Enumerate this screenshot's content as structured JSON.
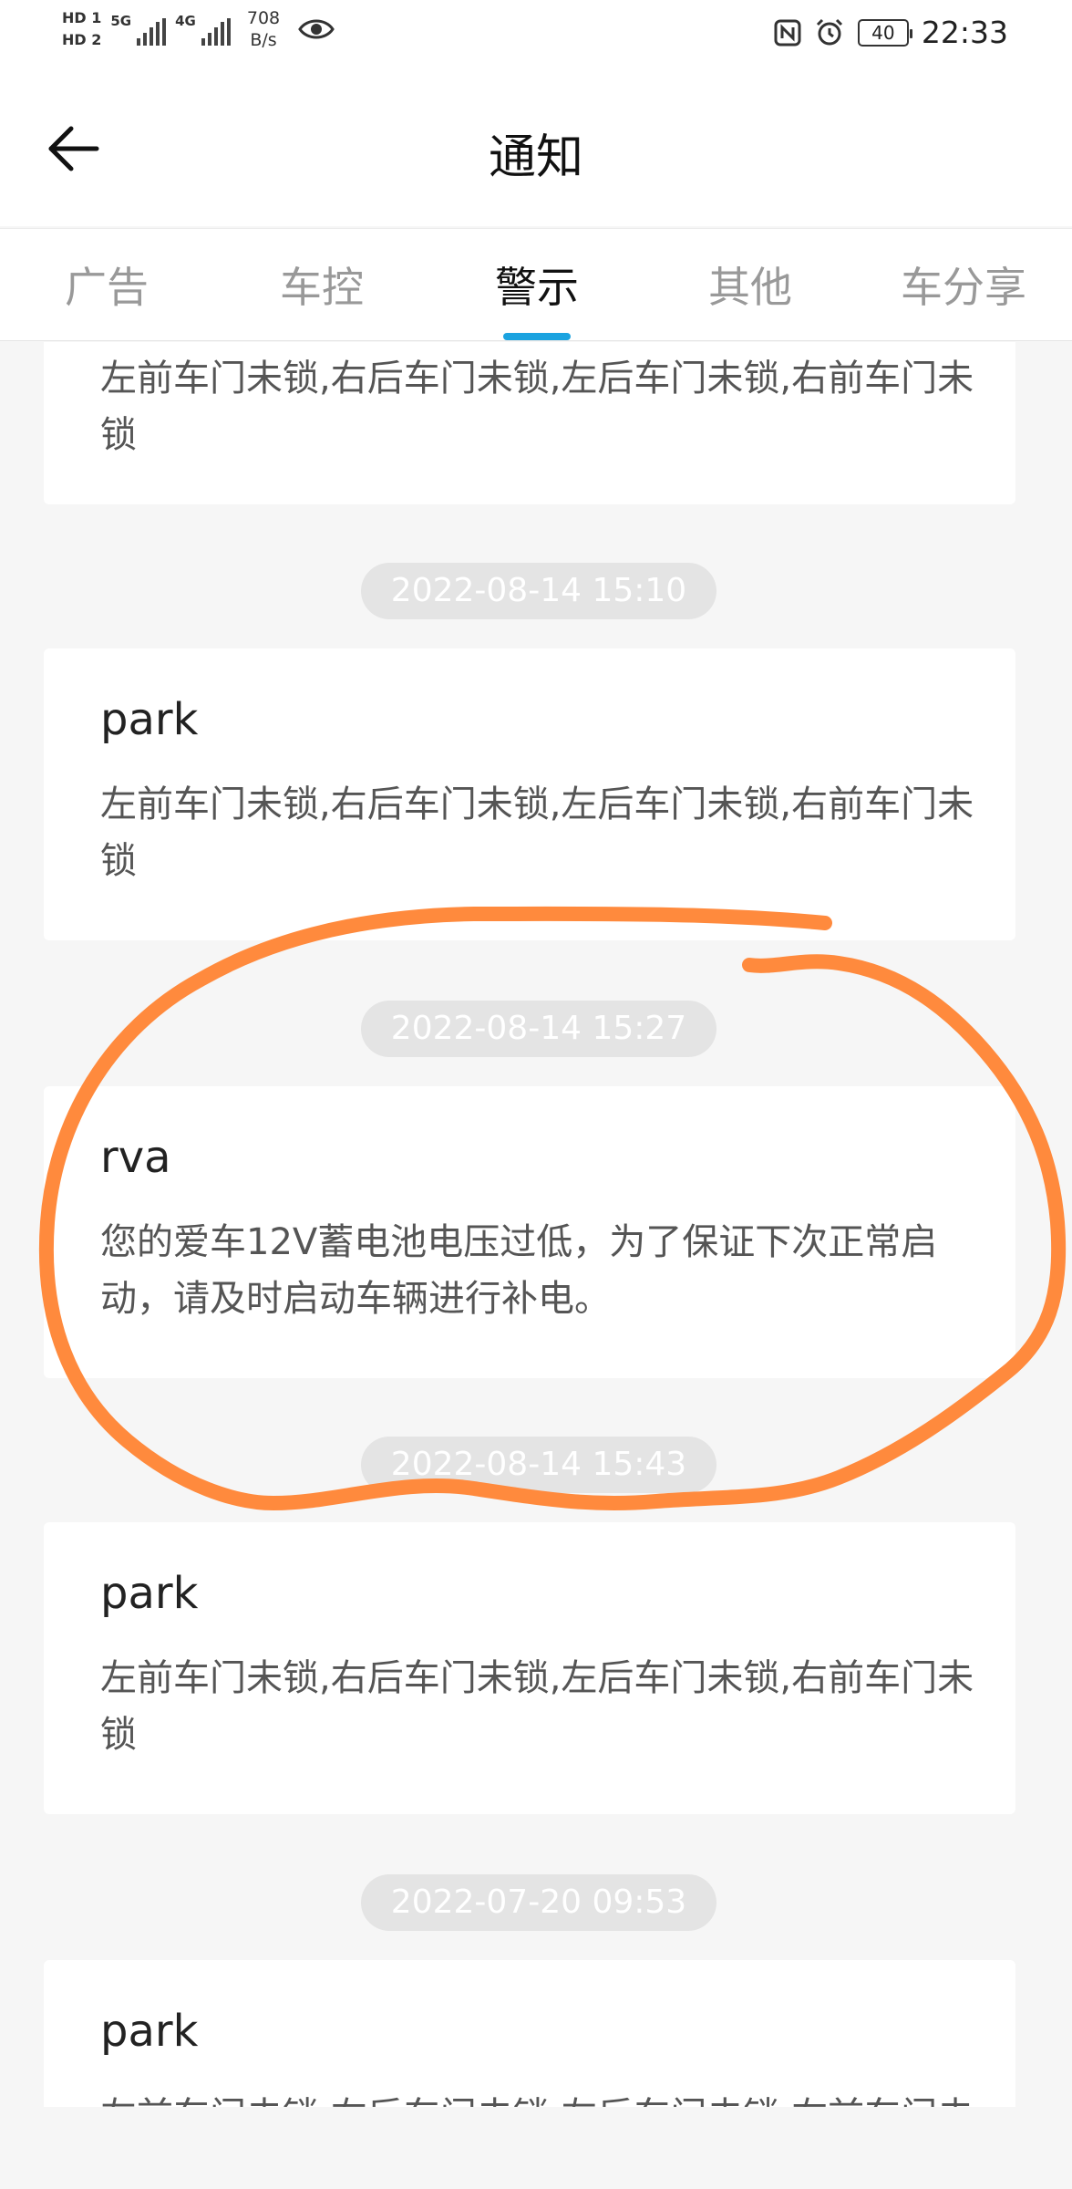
{
  "status_bar": {
    "hd1": "HD 1",
    "hd2": "HD 2",
    "sim1_network": "5G",
    "sim2_network": "4G",
    "speed_value": "708",
    "speed_unit": "B/s",
    "battery": "40",
    "time": "22:33",
    "icons": [
      "eye-icon",
      "nfc-icon",
      "alarm-icon",
      "battery-icon"
    ]
  },
  "header": {
    "title": "通知",
    "back_icon": "arrow-left-icon"
  },
  "tabs": [
    {
      "label": "广告",
      "active": false
    },
    {
      "label": "车控",
      "active": false
    },
    {
      "label": "警示",
      "active": true
    },
    {
      "label": "其他",
      "active": false
    },
    {
      "label": "车分享",
      "active": false
    }
  ],
  "colors": {
    "accent": "#1ba3e0",
    "annotation": "#ff8a3d"
  },
  "notifications": [
    {
      "time": "",
      "title": "",
      "body": "左前车门未锁,右后车门未锁,左后车门未锁,右前车门未锁"
    },
    {
      "time": "2022-08-14 15:10",
      "title": "park",
      "body": "左前车门未锁,右后车门未锁,左后车门未锁,右前车门未锁"
    },
    {
      "time": "2022-08-14 15:27",
      "title": "rva",
      "body": "您的爱车12V蓄电池电压过低，为了保证下次正常启动，请及时启动车辆进行补电。"
    },
    {
      "time": "2022-08-14 15:43",
      "title": "park",
      "body": "左前车门未锁,右后车门未锁,左后车门未锁,右前车门未锁"
    },
    {
      "time": "2022-07-20 09:53",
      "title": "park",
      "body": "左前车门未锁,右后车门未锁,左后车门未锁,右前车门未锁"
    }
  ]
}
